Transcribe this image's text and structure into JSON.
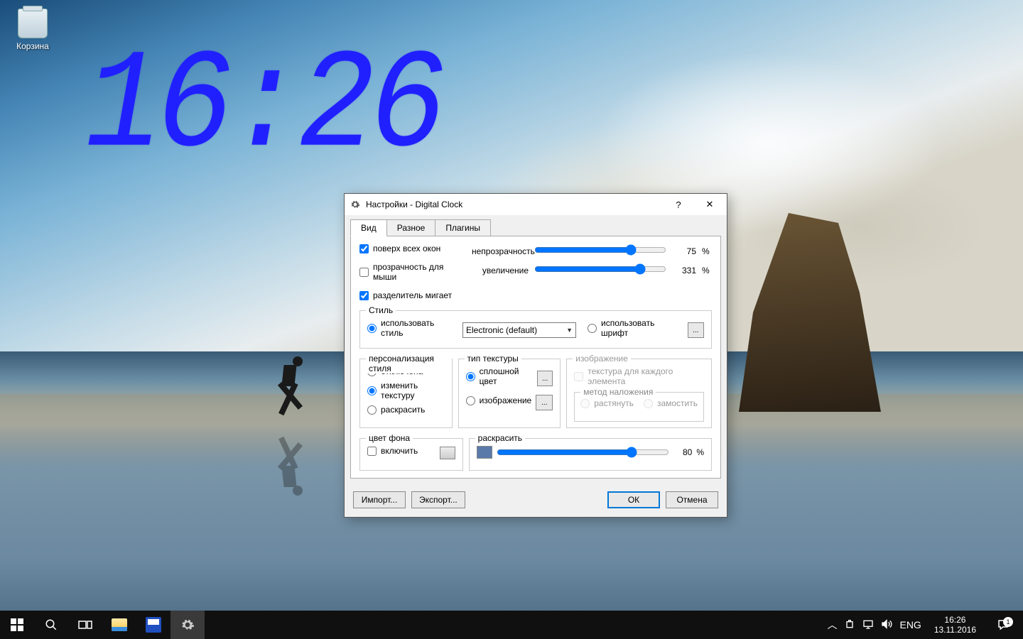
{
  "desktop": {
    "recycle_bin_label": "Корзина",
    "clock_time": "16:26"
  },
  "dialog": {
    "title": "Настройки - Digital Clock",
    "tabs": [
      "Вид",
      "Разное",
      "Плагины"
    ],
    "active_tab": 0,
    "checks": {
      "stay_on_top": {
        "label": "поверх всех окон",
        "checked": true
      },
      "mouse_transparency": {
        "label": "прозрачность для мыши",
        "checked": false
      },
      "separator_flash": {
        "label": "разделитель мигает",
        "checked": true
      }
    },
    "opacity": {
      "label": "непрозрачность",
      "value": 75,
      "unit": "%"
    },
    "zoom": {
      "label": "увеличение",
      "value": 331,
      "unit": "%"
    },
    "style_group": {
      "legend": "Стиль",
      "use_style_label": "использовать стиль",
      "style_selected": "Electronic (default)",
      "use_font_label": "использовать шрифт",
      "font_btn": "...",
      "selected": "style"
    },
    "personalization": {
      "legend": "персонализация стиля",
      "options": [
        "отключена",
        "изменить текстуру",
        "раскрасить"
      ],
      "selected": 1
    },
    "texture_type": {
      "legend": "тип текстуры",
      "solid_label": "сплошной цвет",
      "image_label": "изображение",
      "selected": "solid"
    },
    "image_group": {
      "legend": "изображение",
      "per_element_label": "текстура для каждого элемента",
      "tiling_legend": "метод наложения",
      "stretch_label": "растянуть",
      "tile_label": "замостить"
    },
    "bg_color": {
      "legend": "цвет фона",
      "enable_label": "включить",
      "enabled": false
    },
    "colorize": {
      "legend": "раскрасить",
      "value": 80,
      "unit": "%"
    },
    "buttons": {
      "import": "Импорт...",
      "export": "Экспорт...",
      "ok": "ОК",
      "cancel": "Отмена"
    }
  },
  "taskbar": {
    "lang": "ENG",
    "time": "16:26",
    "date": "13.11.2016",
    "notif_count": "1"
  }
}
